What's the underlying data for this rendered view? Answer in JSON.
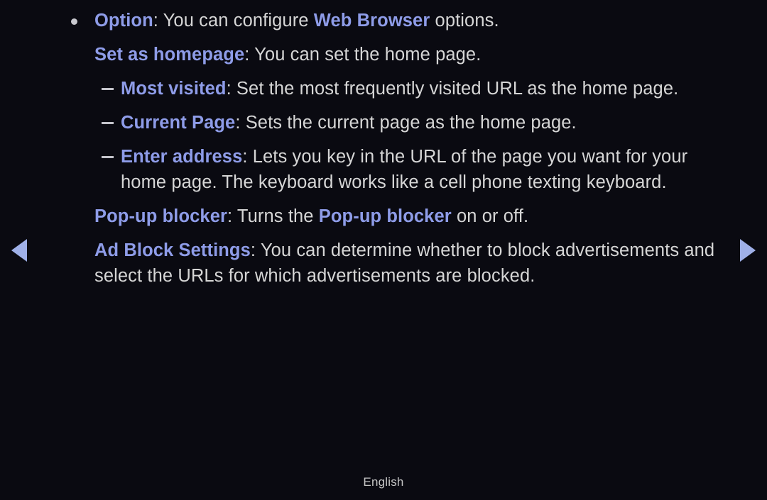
{
  "background_color": "#0a0a11",
  "accent_color": "#8e9ce8",
  "arrow_color": "#9fb0e8",
  "body_text_color": "#d6d6d6",
  "nav": {
    "prev_label": "Previous page",
    "next_label": "Next page",
    "prev_icon": "triangle-left-icon",
    "next_icon": "triangle-right-icon"
  },
  "footer": {
    "language": "English"
  },
  "content": {
    "blocks": [
      {
        "marker": "bullet",
        "lines": [
          [
            {
              "text": "Option",
              "style": "keyword"
            },
            {
              "text": ": You can configure ",
              "style": "body"
            },
            {
              "text": "Web Browser",
              "style": "keyword"
            },
            {
              "text": " options.",
              "style": "body"
            }
          ]
        ]
      },
      {
        "marker": "none",
        "lines": [
          [
            {
              "text": "Set as homepage",
              "style": "keyword"
            },
            {
              "text": ": You can set the home page.",
              "style": "body"
            }
          ]
        ]
      },
      {
        "marker": "dash",
        "lines": [
          [
            {
              "text": "Most visited",
              "style": "keyword"
            },
            {
              "text": ": Set the most frequently visited URL as the home page.",
              "style": "body"
            }
          ]
        ]
      },
      {
        "marker": "dash",
        "lines": [
          [
            {
              "text": "Current Page",
              "style": "keyword"
            },
            {
              "text": ": Sets the current page as the home page.",
              "style": "body"
            }
          ]
        ]
      },
      {
        "marker": "dash",
        "lines": [
          [
            {
              "text": "Enter address",
              "style": "keyword"
            },
            {
              "text": ": Lets you key in the URL of the page you want for your",
              "style": "body"
            }
          ],
          [
            {
              "text": "home page. The keyboard works like a cell phone texting keyboard.",
              "style": "body"
            }
          ]
        ]
      },
      {
        "marker": "none",
        "lines": [
          [
            {
              "text": "Pop-up blocker",
              "style": "keyword"
            },
            {
              "text": ": Turns the ",
              "style": "body"
            },
            {
              "text": "Pop-up blocker",
              "style": "keyword"
            },
            {
              "text": " on or off.",
              "style": "body"
            }
          ]
        ]
      },
      {
        "marker": "none",
        "lines": [
          [
            {
              "text": "Ad Block Settings",
              "style": "keyword"
            },
            {
              "text": ": You can determine whether to block advertisements and",
              "style": "body"
            }
          ],
          [
            {
              "text": "select the URLs for which advertisements are blocked.",
              "style": "body"
            }
          ]
        ]
      }
    ]
  }
}
